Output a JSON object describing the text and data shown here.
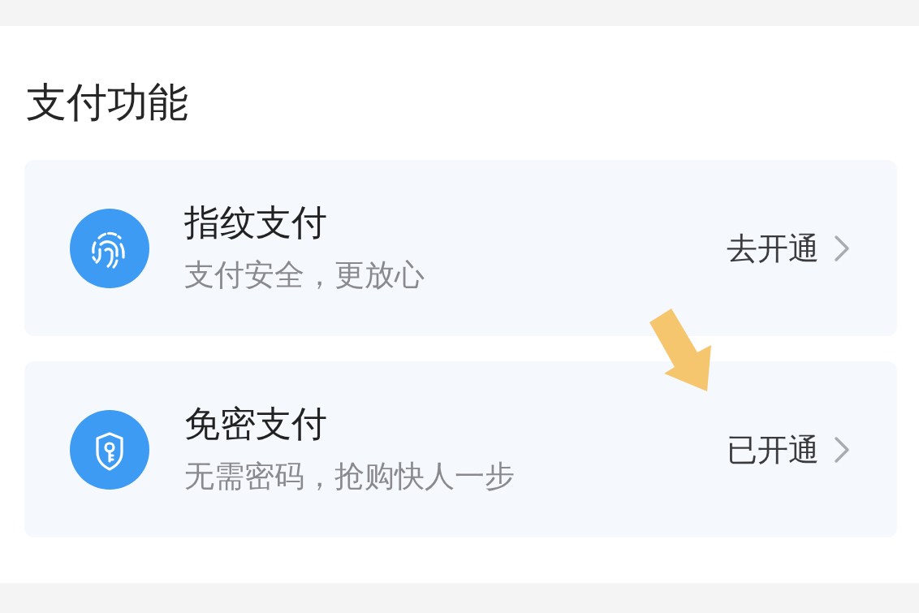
{
  "section": {
    "title": "支付功能"
  },
  "items": [
    {
      "title": "指纹支付",
      "subtitle": "支付安全，更放心",
      "action": "去开通",
      "pointed_at": false
    },
    {
      "title": "免密支付",
      "subtitle": "无需密码，抢购快人一步",
      "action": "已开通",
      "pointed_at": true
    }
  ]
}
